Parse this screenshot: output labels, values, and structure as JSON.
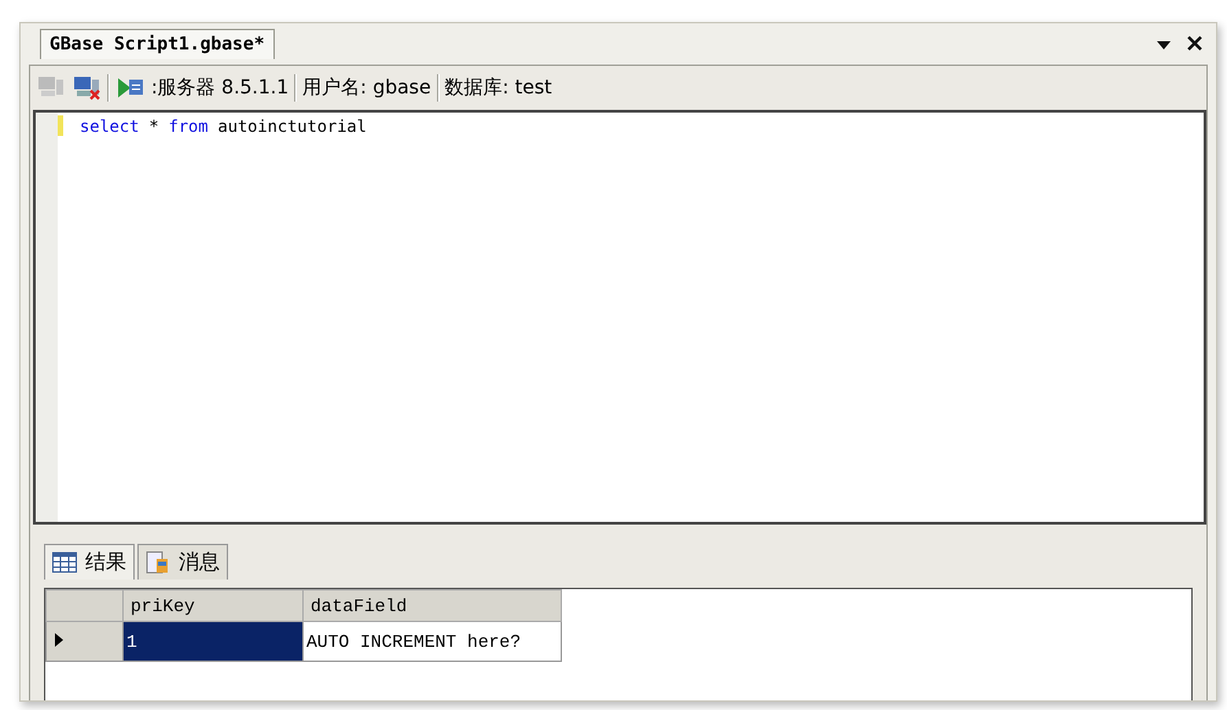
{
  "document_tab": {
    "title": "GBase Script1.gbase*",
    "selected": true
  },
  "toolbar": {
    "items": [
      {
        "kind": "separator"
      },
      {
        "kind": "label",
        "text": ":服务器 8.5.1.1"
      },
      {
        "kind": "separator"
      },
      {
        "kind": "label",
        "text": "用户名: gbase"
      },
      {
        "kind": "separator"
      },
      {
        "kind": "label",
        "text": "数据库: test"
      }
    ]
  },
  "editor": {
    "lines": [
      {
        "modified": true,
        "tokens": [
          {
            "kind": "keyword",
            "text": "select"
          },
          {
            "kind": "plain",
            "text": "*"
          },
          {
            "kind": "keyword",
            "text": "from"
          },
          {
            "kind": "plain",
            "text": "autoinctutorial"
          }
        ]
      }
    ]
  },
  "result_tabs": [
    {
      "label": "结果",
      "kind": "grid",
      "selected": true
    },
    {
      "label": "消息",
      "kind": "messages",
      "selected": false
    }
  ],
  "grid": {
    "columns": [
      "priKey",
      "dataField"
    ],
    "rows": [
      {
        "current": true,
        "cells": [
          {
            "text": "1",
            "selected": true
          },
          {
            "text": "AUTO INCREMENT here?",
            "selected": false
          }
        ]
      }
    ]
  }
}
